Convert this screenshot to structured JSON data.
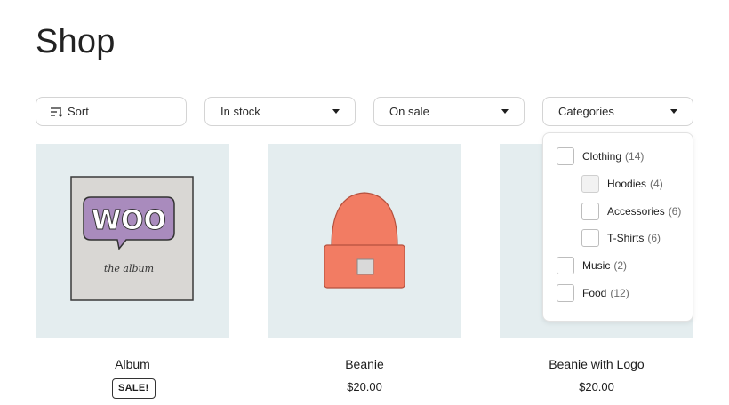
{
  "page": {
    "title": "Shop"
  },
  "filters": {
    "sort": {
      "label": "Sort",
      "icon": "sort-icon"
    },
    "in_stock": {
      "label": "In stock",
      "icon": "chevron-down-icon"
    },
    "on_sale": {
      "label": "On sale",
      "icon": "chevron-down-icon"
    },
    "categories": {
      "label": "Categories",
      "icon": "chevron-down-icon"
    }
  },
  "category_menu": {
    "items": [
      {
        "name": "Clothing",
        "count": "(14)",
        "level": 0,
        "checked": false
      },
      {
        "name": "Hoodies",
        "count": "(4)",
        "level": 1,
        "checked": false,
        "hovered": true
      },
      {
        "name": "Accessories",
        "count": "(6)",
        "level": 1,
        "checked": false
      },
      {
        "name": "T-Shirts",
        "count": "(6)",
        "level": 1,
        "checked": false
      },
      {
        "name": "Music",
        "count": "(2)",
        "level": 0,
        "checked": false
      },
      {
        "name": "Food",
        "count": "(12)",
        "level": 0,
        "checked": false
      }
    ]
  },
  "products": [
    {
      "name": "Album",
      "price": "",
      "badge": "SALE!",
      "image": {
        "text_main": "WOO",
        "text_sub": "the album",
        "colors": {
          "card": "#d9d7d4",
          "bubble": "#a98bbd"
        }
      }
    },
    {
      "name": "Beanie",
      "price": "$20.00",
      "badge": "",
      "image": {
        "colors": {
          "hat": "#f27c63",
          "patch": "#d9d9d9"
        }
      }
    },
    {
      "name": "Beanie with Logo",
      "price": "$20.00",
      "badge": ""
    }
  ],
  "colors": {
    "image_bg": "#e4edef",
    "border": "#d4d4d4"
  }
}
